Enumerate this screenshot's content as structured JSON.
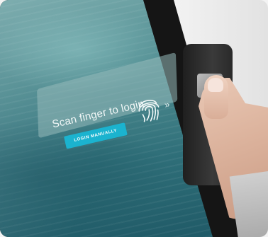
{
  "screen": {
    "prompt_text": "Scan finger to login",
    "chevron_glyph": "»",
    "login_button_label": "LOGIN MANUALLY",
    "fingerprint_icon": "fingerprint-icon"
  },
  "colors": {
    "button_accent": "#1bb3cf",
    "screen_ocean": "#2f6f79",
    "card_overlay": "#96b9b9"
  }
}
